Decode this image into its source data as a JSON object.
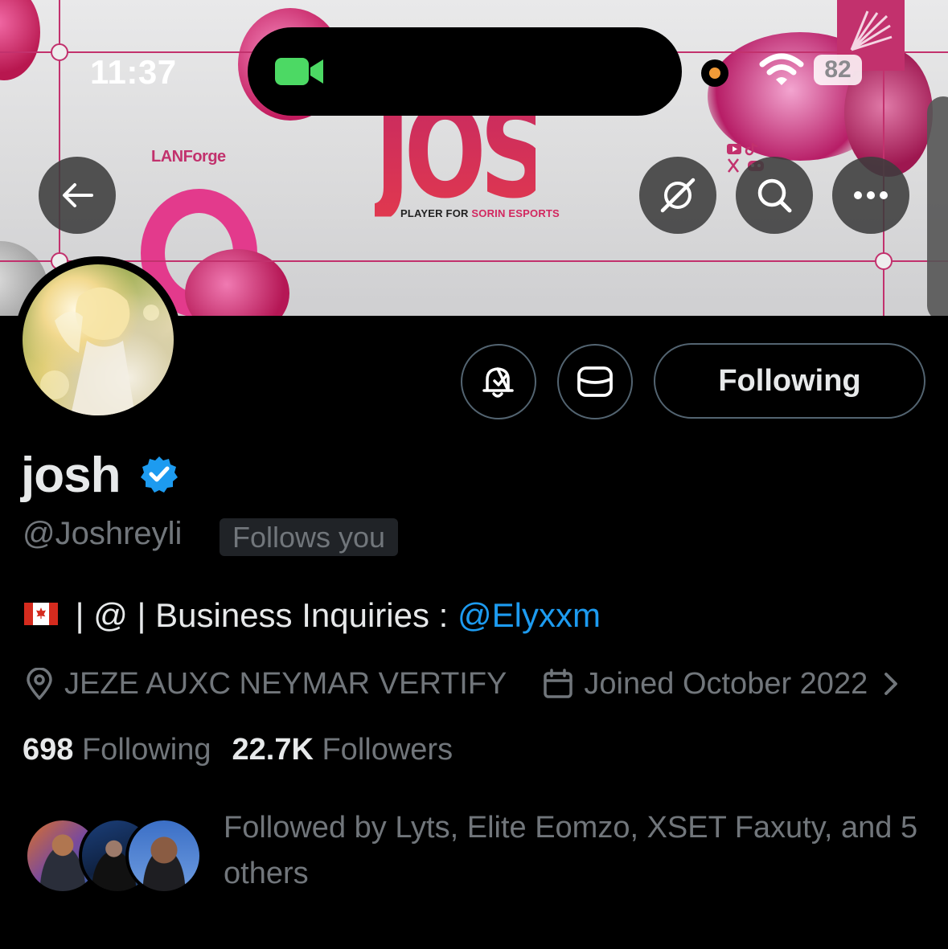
{
  "status_bar": {
    "time": "11:37",
    "battery": "82"
  },
  "banner": {
    "brand": "LANForge",
    "title": "JOSH",
    "subtitle_prefix": "PLAYER FOR ",
    "subtitle_highlight": "SORIN ESPORTS",
    "accent_color": "#c2316d"
  },
  "header_buttons": {
    "back": "arrow-left-icon",
    "grok": "grok-icon",
    "search": "search-icon",
    "more": "more-icon"
  },
  "actions": {
    "notify_icon": "bell-check-icon",
    "message_icon": "envelope-icon",
    "follow_label": "Following"
  },
  "profile": {
    "display_name": "josh",
    "handle": "@Joshreyli",
    "follows_you": "Follows you",
    "bio_text": " | @ | Business Inquiries : ",
    "bio_mention": "@Elyxxm",
    "location": "JEZE AUXC NEYMAR VERTIFY",
    "joined": "Joined October 2022",
    "following_count": "698",
    "following_label": "Following",
    "followers_count": "22.7K",
    "followers_label": "Followers",
    "followed_by": "Followed by Lyts, Elite Eomzo, XSET Faxuty, and 5 others"
  },
  "colors": {
    "background": "#000000",
    "text_primary": "#e7e9ea",
    "text_secondary": "#71767b",
    "link": "#1d9bf0",
    "border": "#536471"
  }
}
